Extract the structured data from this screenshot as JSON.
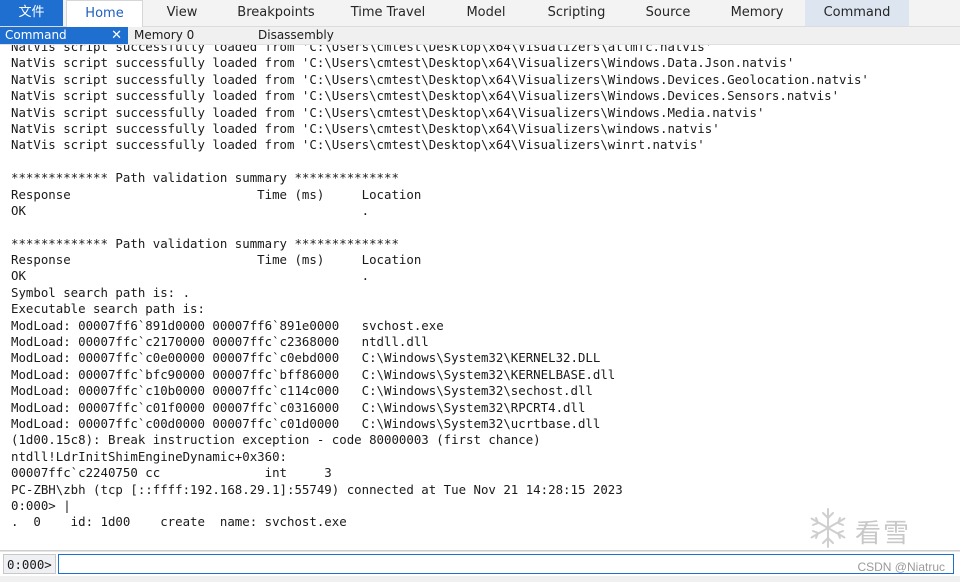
{
  "ribbon": {
    "tabs": [
      {
        "label": "文件"
      },
      {
        "label": "Home"
      },
      {
        "label": "View"
      },
      {
        "label": "Breakpoints"
      },
      {
        "label": "Time Travel"
      },
      {
        "label": "Model"
      },
      {
        "label": "Scripting"
      },
      {
        "label": "Source"
      },
      {
        "label": "Memory"
      },
      {
        "label": "Command"
      }
    ]
  },
  "doc_tabs": [
    {
      "label": "Command",
      "close": "✕"
    },
    {
      "label": "Memory 0"
    },
    {
      "label": "Disassembly"
    }
  ],
  "output_lines": [
    "NatVis script successfully loaded from 'C:\\Users\\cmtest\\Desktop\\x64\\Visualizers\\atlmfc.natvis'",
    "NatVis script successfully loaded from 'C:\\Users\\cmtest\\Desktop\\x64\\Visualizers\\Windows.Data.Json.natvis'",
    "NatVis script successfully loaded from 'C:\\Users\\cmtest\\Desktop\\x64\\Visualizers\\Windows.Devices.Geolocation.natvis'",
    "NatVis script successfully loaded from 'C:\\Users\\cmtest\\Desktop\\x64\\Visualizers\\Windows.Devices.Sensors.natvis'",
    "NatVis script successfully loaded from 'C:\\Users\\cmtest\\Desktop\\x64\\Visualizers\\Windows.Media.natvis'",
    "NatVis script successfully loaded from 'C:\\Users\\cmtest\\Desktop\\x64\\Visualizers\\windows.natvis'",
    "NatVis script successfully loaded from 'C:\\Users\\cmtest\\Desktop\\x64\\Visualizers\\winrt.natvis'",
    "",
    "************* Path validation summary **************",
    "Response                         Time (ms)     Location",
    "OK                                             .",
    "",
    "************* Path validation summary **************",
    "Response                         Time (ms)     Location",
    "OK                                             .",
    "Symbol search path is: .",
    "Executable search path is:",
    "ModLoad: 00007ff6`891d0000 00007ff6`891e0000   svchost.exe",
    "ModLoad: 00007ffc`c2170000 00007ffc`c2368000   ntdll.dll",
    "ModLoad: 00007ffc`c0e00000 00007ffc`c0ebd000   C:\\Windows\\System32\\KERNEL32.DLL",
    "ModLoad: 00007ffc`bfc90000 00007ffc`bff86000   C:\\Windows\\System32\\KERNELBASE.dll",
    "ModLoad: 00007ffc`c10b0000 00007ffc`c114c000   C:\\Windows\\System32\\sechost.dll",
    "ModLoad: 00007ffc`c01f0000 00007ffc`c0316000   C:\\Windows\\System32\\RPCRT4.dll",
    "ModLoad: 00007ffc`c00d0000 00007ffc`c01d0000   C:\\Windows\\System32\\ucrtbase.dll",
    "(1d00.15c8): Break instruction exception - code 80000003 (first chance)",
    "ntdll!LdrInitShimEngineDynamic+0x360:",
    "00007ffc`c2240750 cc              int     3",
    "PC-ZBH\\zbh (tcp [::ffff:192.168.29.1]:55749) connected at Tue Nov 21 14:28:15 2023",
    "0:000> |",
    ".  0    id: 1d00    create  name: svchost.exe"
  ],
  "command_bar": {
    "prompt": "0:000>",
    "input_value": ""
  },
  "watermark": {
    "text": "看雪"
  },
  "credit": "CSDN @Niatruc"
}
